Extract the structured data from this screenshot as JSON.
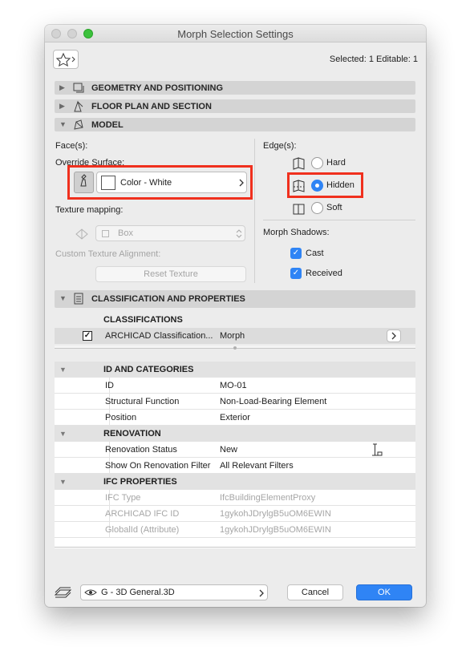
{
  "window": {
    "title": "Morph Selection Settings"
  },
  "toolbar": {
    "selected_text": "Selected: 1 Editable: 1"
  },
  "panels": [
    {
      "label": "GEOMETRY AND POSITIONING"
    },
    {
      "label": "FLOOR PLAN AND SECTION"
    },
    {
      "label": "MODEL"
    }
  ],
  "model": {
    "faces_label": "Face(s):",
    "override_surface_label": "Override Surface:",
    "surface_value": "Color - White",
    "texture_mapping_label": "Texture mapping:",
    "texture_value": "Box",
    "custom_texture_label": "Custom Texture Alignment:",
    "reset_texture_label": "Reset Texture",
    "edges_label": "Edge(s):",
    "edge_options": [
      "Hard",
      "Hidden",
      "Soft"
    ],
    "edge_selected": "Hidden",
    "shadows_label": "Morph Shadows:",
    "shadow_cast": "Cast",
    "shadow_received": "Received"
  },
  "classification": {
    "header": "CLASSIFICATION AND PROPERTIES",
    "sub_header": "CLASSIFICATIONS",
    "row_name": "ARCHICAD Classification...",
    "row_value": "Morph"
  },
  "properties": {
    "sections": [
      {
        "title": "ID AND CATEGORIES",
        "rows": [
          {
            "key": "ID",
            "value": "MO-01"
          },
          {
            "key": "Structural Function",
            "value": "Non-Load-Bearing Element"
          },
          {
            "key": "Position",
            "value": "Exterior"
          }
        ]
      },
      {
        "title": "RENOVATION",
        "rows": [
          {
            "key": "Renovation Status",
            "value": "New"
          },
          {
            "key": "Show On Renovation Filter",
            "value": "All Relevant Filters"
          }
        ]
      },
      {
        "title": "IFC PROPERTIES",
        "rows": [
          {
            "key": "IFC Type",
            "value": "IfcBuildingElementProxy"
          },
          {
            "key": "ARCHICAD IFC ID",
            "value": "1gykohJDrylgB5uOM6EWIN"
          },
          {
            "key": "GlobalId (Attribute)",
            "value": "1gykohJDrylgB5uOM6EWIN"
          }
        ]
      }
    ]
  },
  "footer": {
    "view_value": "G - 3D General.3D",
    "cancel_label": "Cancel",
    "ok_label": "OK"
  },
  "colors": {
    "accent": "#2f84f5",
    "highlight_box": "#f0301e"
  }
}
